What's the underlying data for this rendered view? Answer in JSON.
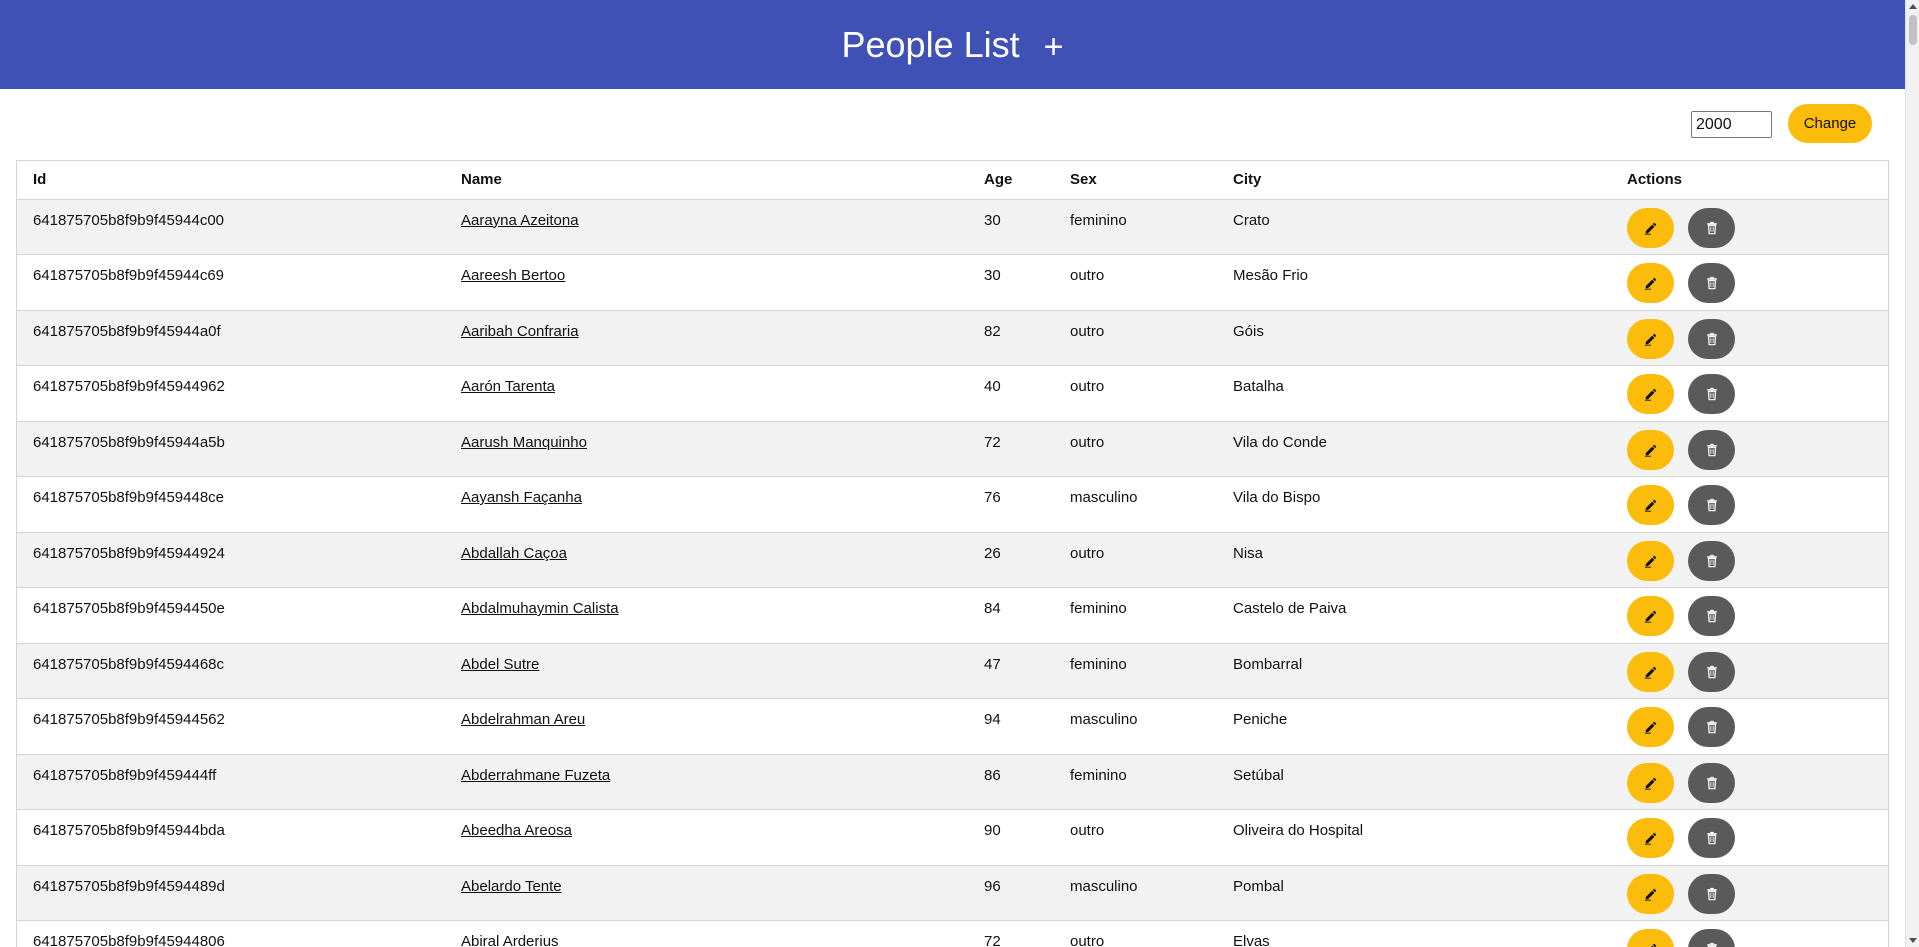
{
  "header": {
    "title": "People List",
    "add_label": "+"
  },
  "controls": {
    "limit_value": "2000",
    "change_label": "Change"
  },
  "table": {
    "columns": [
      "Id",
      "Name",
      "Age",
      "Sex",
      "City",
      "Actions"
    ],
    "rows": [
      {
        "id": "641875705b8f9b9f45944c00",
        "name": "Aarayna Azeitona",
        "age": "30",
        "sex": "feminino",
        "city": "Crato"
      },
      {
        "id": "641875705b8f9b9f45944c69",
        "name": "Aareesh Bertoo",
        "age": "30",
        "sex": "outro",
        "city": "Mesão Frio"
      },
      {
        "id": "641875705b8f9b9f45944a0f",
        "name": "Aaribah Confraria",
        "age": "82",
        "sex": "outro",
        "city": "Góis"
      },
      {
        "id": "641875705b8f9b9f45944962",
        "name": "Aarón Tarenta",
        "age": "40",
        "sex": "outro",
        "city": "Batalha"
      },
      {
        "id": "641875705b8f9b9f45944a5b",
        "name": "Aarush Manquinho",
        "age": "72",
        "sex": "outro",
        "city": "Vila do Conde"
      },
      {
        "id": "641875705b8f9b9f459448ce",
        "name": "Aayansh Façanha",
        "age": "76",
        "sex": "masculino",
        "city": "Vila do Bispo"
      },
      {
        "id": "641875705b8f9b9f45944924",
        "name": "Abdallah Caçoa",
        "age": "26",
        "sex": "outro",
        "city": "Nisa"
      },
      {
        "id": "641875705b8f9b9f4594450e",
        "name": "Abdalmuhaymin Calista",
        "age": "84",
        "sex": "feminino",
        "city": "Castelo de Paiva"
      },
      {
        "id": "641875705b8f9b9f4594468c",
        "name": "Abdel Sutre",
        "age": "47",
        "sex": "feminino",
        "city": "Bombarral"
      },
      {
        "id": "641875705b8f9b9f45944562",
        "name": "Abdelrahman Areu",
        "age": "94",
        "sex": "masculino",
        "city": "Peniche"
      },
      {
        "id": "641875705b8f9b9f459444ff",
        "name": "Abderrahmane Fuzeta",
        "age": "86",
        "sex": "feminino",
        "city": "Setúbal"
      },
      {
        "id": "641875705b8f9b9f45944bda",
        "name": "Abeedha Areosa",
        "age": "90",
        "sex": "outro",
        "city": "Oliveira do Hospital"
      },
      {
        "id": "641875705b8f9b9f4594489d",
        "name": "Abelardo Tente",
        "age": "96",
        "sex": "masculino",
        "city": "Pombal"
      },
      {
        "id": "641875705b8f9b9f45944806",
        "name": "Abiral Arderius",
        "age": "72",
        "sex": "outro",
        "city": "Elvas"
      }
    ]
  },
  "icons": {
    "edit": "edit-icon",
    "delete": "trash-icon"
  },
  "colors": {
    "header_bg": "#3f51b5",
    "accent": "#fcbc0c",
    "delete_bg": "#5a5a5a"
  }
}
